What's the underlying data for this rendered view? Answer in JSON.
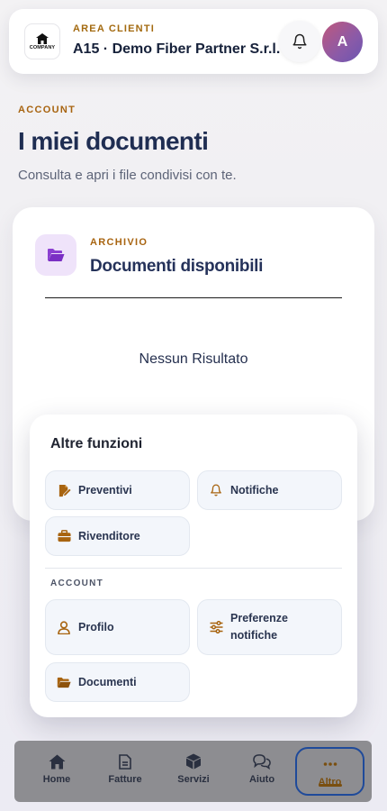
{
  "header": {
    "logo_text": "COMPANY",
    "logo_subtext": "",
    "eyebrow": "AREA CLIENTI",
    "company_name": "A15 · Demo Fiber Partner S.r.l.",
    "avatar_initial": "A",
    "bell_icon": "bell-icon"
  },
  "page": {
    "eyebrow": "ACCOUNT",
    "title": "I miei documenti",
    "subtitle": "Consulta e apri i file condivisi con te."
  },
  "card": {
    "icon": "folder-open-icon",
    "eyebrow": "ARCHIVIO",
    "title": "Documenti disponibili",
    "empty_text": "Nessun Risultato"
  },
  "popup": {
    "title": "Altre funzioni",
    "functions": [
      {
        "label": "Preventivi",
        "icon": "file-signature-icon"
      },
      {
        "label": "Notifiche",
        "icon": "bell-icon"
      },
      {
        "label": "Rivenditore",
        "icon": "briefcase-icon"
      }
    ],
    "account_eyebrow": "ACCOUNT",
    "account_items": [
      {
        "label": "Profilo",
        "icon": "user-icon"
      },
      {
        "label": "Preferenze notifiche",
        "icon": "sliders-icon"
      },
      {
        "label": "Documenti",
        "icon": "folder-open-icon"
      }
    ]
  },
  "tabbar": {
    "tabs": [
      {
        "label": "Home",
        "icon": "home-icon"
      },
      {
        "label": "Fatture",
        "icon": "invoice-icon"
      },
      {
        "label": "Servizi",
        "icon": "box-icon"
      },
      {
        "label": "Aiuto",
        "icon": "chat-icon"
      },
      {
        "label": "Altro",
        "icon": "more-icon",
        "active": true
      }
    ]
  },
  "colors": {
    "accent_gold": "#a86410",
    "title_navy": "#1f2d52",
    "active_tab_border": "#1f4a9a",
    "tabbar_bg": "#8d8d91",
    "folder_tile_bg": "#efe3fa"
  }
}
